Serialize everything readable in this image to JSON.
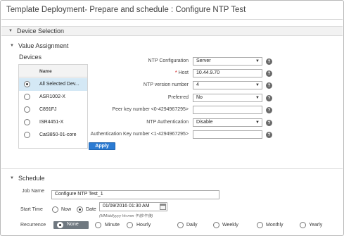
{
  "window": {
    "title": "Template Deployment- Prepare and schedule : Configure NTP Test"
  },
  "sections": {
    "device_selection": "Device Selection",
    "value_assignment": "Value Assignment",
    "schedule": "Schedule"
  },
  "devices": {
    "title": "Devices",
    "column_header": "Name",
    "rows": [
      {
        "name": "All Selected Dev...",
        "selected": true
      },
      {
        "name": "ASR1002-X",
        "selected": false
      },
      {
        "name": "C891FJ",
        "selected": false
      },
      {
        "name": "ISR4451-X",
        "selected": false
      },
      {
        "name": "Cat3850-01-core",
        "selected": false
      }
    ],
    "apply_label": "Apply"
  },
  "form": {
    "ntp_configuration": {
      "label": "NTP Configuration",
      "value": "Server"
    },
    "host": {
      "required_mark": "*",
      "label": "Host",
      "value": "10.44.9.70"
    },
    "ntp_version": {
      "label": "NTP version number",
      "value": "4"
    },
    "preferred": {
      "label": "Preferred",
      "value": "No"
    },
    "peer_key": {
      "label": "Peer key number <0-4294967295>",
      "value": ""
    },
    "ntp_auth": {
      "label": "NTP Authentication",
      "value": "Disable"
    },
    "auth_key": {
      "label": "Authentication Key number <1-4294967295>",
      "value": ""
    },
    "help_glyph": "?"
  },
  "schedule": {
    "job_name_label": "Job Name",
    "job_name_value": "Configure NTP Test_1",
    "start_time_label": "Start Time",
    "start_now": "Now",
    "start_date": "Date",
    "date_value": "01/09/2016 01:30 AM",
    "date_hint": "(MM/dd/yyyy hh:mm 午前/午後)",
    "recurrence_label": "Recurrence",
    "recurrence_options": [
      "None",
      "Minute",
      "Hourly",
      "Daily",
      "Weekly",
      "Monthly",
      "Yearly"
    ],
    "recurrence_selected": "None"
  },
  "icons": {
    "collapse": "triangle-down-icon",
    "help": "question-circle-icon",
    "calendar": "calendar-icon"
  }
}
